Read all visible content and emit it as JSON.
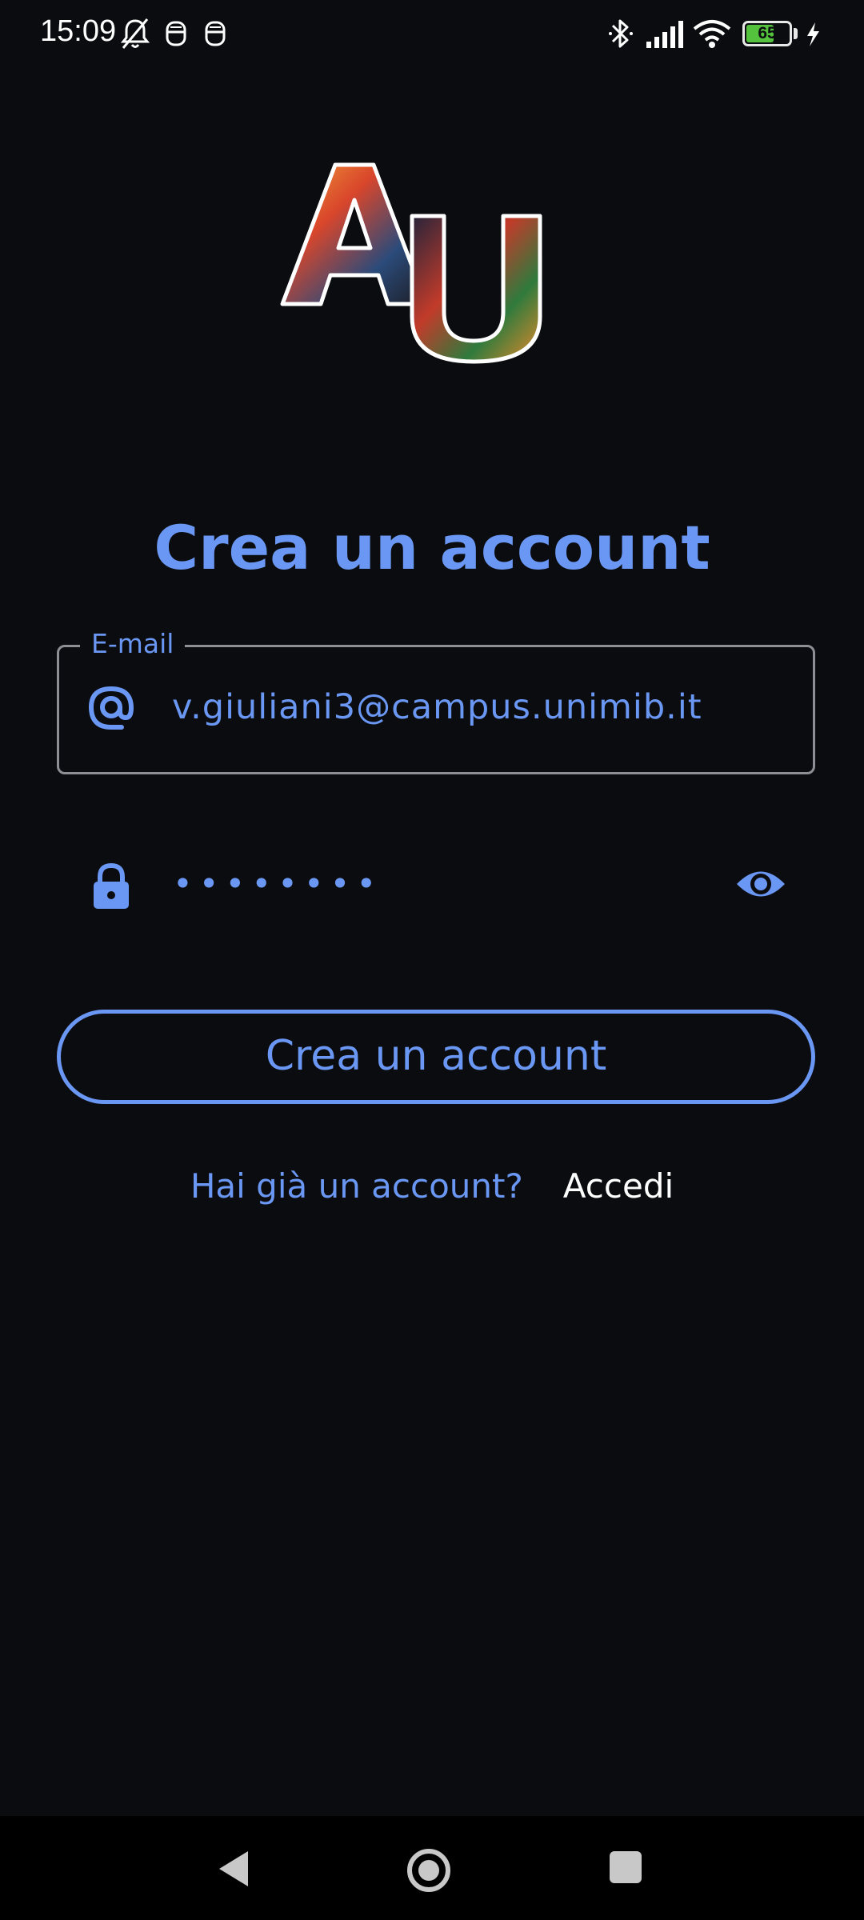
{
  "status_bar": {
    "time": "15:09",
    "battery_level": "65",
    "battery_percent": 65,
    "icons": [
      "bell-off-icon",
      "notification-icon",
      "notification-icon",
      "bluetooth-icon",
      "signal-icon",
      "wifi-icon",
      "battery-icon",
      "charging-icon"
    ]
  },
  "logo": {
    "letters": "AU"
  },
  "title": "Crea un account",
  "email": {
    "label": "E-mail",
    "value": "v.giuliani3@campus.unimib.it",
    "icon": "at-icon"
  },
  "password": {
    "masked_value": "••••••••",
    "icon": "lock-icon",
    "toggle_icon": "eye-icon"
  },
  "create_button_label": "Crea un account",
  "login_prompt": {
    "question": "Hai già un account?",
    "link": "Accedi"
  },
  "nav_bar": {
    "icons": [
      "back-icon",
      "home-icon",
      "recents-icon"
    ]
  },
  "colors": {
    "accent": "#6a97f3",
    "background": "#0b0c0f"
  }
}
